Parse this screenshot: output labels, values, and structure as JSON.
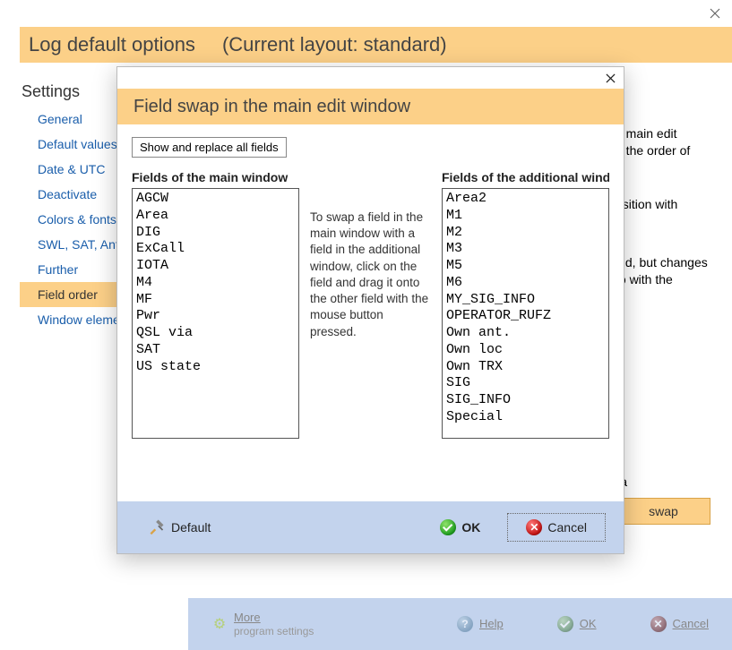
{
  "outer": {
    "title": "Log default options",
    "layout": "(Current layout: standard)"
  },
  "settings": {
    "title": "Settings",
    "items": [
      {
        "label": "General"
      },
      {
        "label": "Default values"
      },
      {
        "label": "Date & UTC"
      },
      {
        "label": "Deactivate"
      },
      {
        "label": "Colors & fonts"
      },
      {
        "label": "SWL, SAT, Antenna"
      },
      {
        "label": "Further"
      },
      {
        "label": "Field order",
        "selected": true
      },
      {
        "label": "Window elements"
      }
    ]
  },
  "bg": {
    "line1a": "e main edit",
    "line1b": "n the order of",
    "line2": "osition with",
    "line3a": "eld, but changes",
    "line3b": "to with the",
    "mark": "a",
    "swap_label": "swap"
  },
  "dialog": {
    "title": "Field swap in the main edit window",
    "toggle": "Show and replace all fields",
    "left_title": "Fields of the main window",
    "right_title": "Fields of the additional window",
    "instruction": "To swap a field in the main window with a field in the additional window, click on the field and drag it onto the other field with the mouse button pressed.",
    "left_items": [
      "AGCW",
      "Area",
      "DIG",
      "ExCall",
      "IOTA",
      "M4",
      "MF",
      "Pwr",
      "QSL via",
      "SAT",
      "US state"
    ],
    "right_items": [
      "Area2",
      "M1",
      "M2",
      "M3",
      "M5",
      "M6",
      "MY_SIG_INFO",
      "OPERATOR_RUFZ",
      "Own ant.",
      "Own loc",
      "Own TRX",
      "SIG",
      "SIG_INFO",
      "Special"
    ],
    "default_label": "Default",
    "ok_label": "OK",
    "cancel_label": "Cancel"
  },
  "footer": {
    "more": "More",
    "more_sub": "program settings",
    "help": "Help",
    "ok": "OK",
    "cancel": "Cancel"
  }
}
